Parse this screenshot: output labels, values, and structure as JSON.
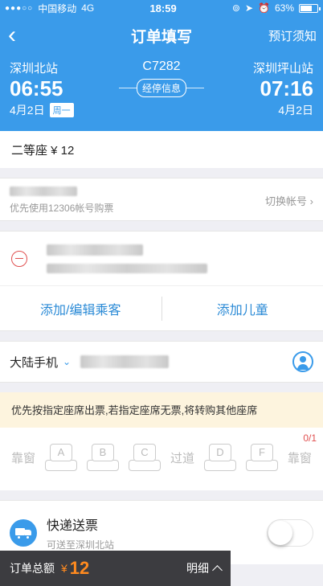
{
  "status_bar": {
    "signal": "●●●○○",
    "carrier": "中国移动",
    "network": "4G",
    "time": "18:59",
    "icons": [
      "orientation-lock-icon",
      "location-icon",
      "alarm-icon"
    ],
    "battery": "63%"
  },
  "nav": {
    "back_icon": "‹",
    "title": "订单填写",
    "right_label": "预订须知"
  },
  "train": {
    "from_station": "深圳北站",
    "from_time": "06:55",
    "from_date": "4月2日",
    "weekday": "周一",
    "train_no": "C7282",
    "stops_label": "经停信息",
    "to_station": "深圳坪山站",
    "to_time": "07:16",
    "to_date": "4月2日"
  },
  "seat": {
    "label": "二等座 ¥ 12"
  },
  "account": {
    "hint": "优先使用12306帐号购票",
    "switch_label": "切换帐号",
    "switch_icon": "›"
  },
  "passengers": {
    "add_edit_label": "添加/编辑乘客",
    "add_child_label": "添加儿童"
  },
  "contact": {
    "phone_region": "大陆手机",
    "dropdown_icon": "⌄"
  },
  "notice": {
    "text": "优先按指定座席出票,若指定座席无票,将转购其他座席"
  },
  "seat_select": {
    "count": "0/1",
    "window_left": "靠窗",
    "aisle": "过道",
    "window_right": "靠窗",
    "seats_left": [
      "A",
      "B",
      "C"
    ],
    "seats_right": [
      "D",
      "F"
    ]
  },
  "delivery": {
    "title": "快递送票",
    "subtitle": "可送至深圳北站",
    "enabled": false
  },
  "bottom_bar": {
    "total_label": "订单总额",
    "currency": "¥",
    "amount": "12",
    "detail_label": "明细"
  },
  "colors": {
    "primary": "#3a9bea",
    "accent_orange": "#ff8a1f",
    "danger": "#e05050",
    "notice_bg": "#fdf4de"
  }
}
